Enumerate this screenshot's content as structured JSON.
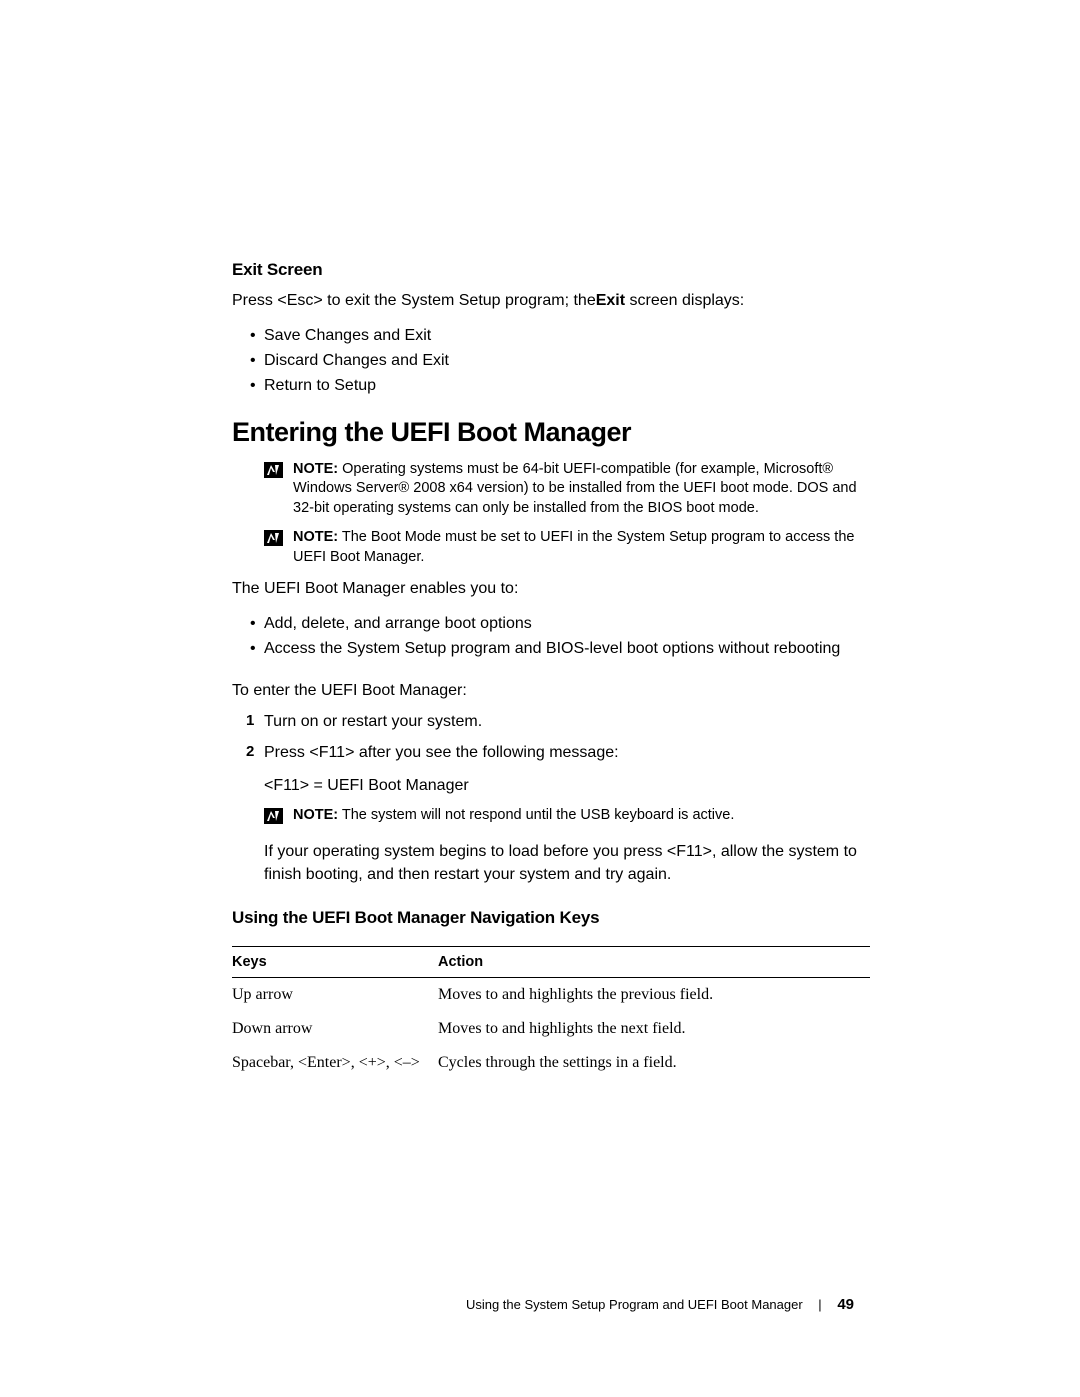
{
  "exit": {
    "heading": "Exit Screen",
    "intro_a": "Press <Esc> to exit the System Setup program; the",
    "intro_b": "Exit",
    "intro_c": " screen displays:",
    "items": [
      "Save Changes and Exit",
      "Discard Changes and Exit",
      "Return to Setup"
    ]
  },
  "uefi": {
    "heading": "Entering the UEFI Boot Manager",
    "note1_label": "NOTE:",
    "note1_text": " Operating systems must be 64-bit UEFI-compatible (for example, Microsoft® Windows Server® 2008 x64 version) to be installed from the UEFI boot mode. DOS and 32-bit operating systems can only be installed from the BIOS boot mode.",
    "note2_label": "NOTE:",
    "note2_text": " The Boot Mode must be set to UEFI in the System Setup program to access the UEFI Boot Manager.",
    "enables": "The UEFI Boot Manager enables you to:",
    "bullets": [
      "Add, delete, and arrange boot options",
      "Access the System Setup program and BIOS-level boot options without rebooting"
    ],
    "toenter": "To enter the UEFI Boot Manager:",
    "step1": "Turn on or restart your system.",
    "step2": "Press <F11> after you see the following message:",
    "step2_msg": "<F11> = UEFI Boot Manager",
    "note3_label": "NOTE:",
    "note3_text": " The system will not respond until the USB keyboard is active.",
    "step2_after": "If your operating system begins to load before you press <F11>, allow the system to finish booting, and then restart your system and try again."
  },
  "nav": {
    "heading": "Using the UEFI Boot Manager Navigation Keys",
    "col_keys": "Keys",
    "col_action": "Action",
    "rows": [
      {
        "k": "Up arrow",
        "a": "Moves to and highlights the previous field."
      },
      {
        "k": "Down arrow",
        "a": "Moves to and highlights the next field."
      },
      {
        "k": "Spacebar, <Enter>, <+>, <–>",
        "a": "Cycles through the settings in a field."
      }
    ]
  },
  "footer": {
    "title": "Using the System Setup Program and UEFI Boot Manager",
    "page": "49"
  }
}
